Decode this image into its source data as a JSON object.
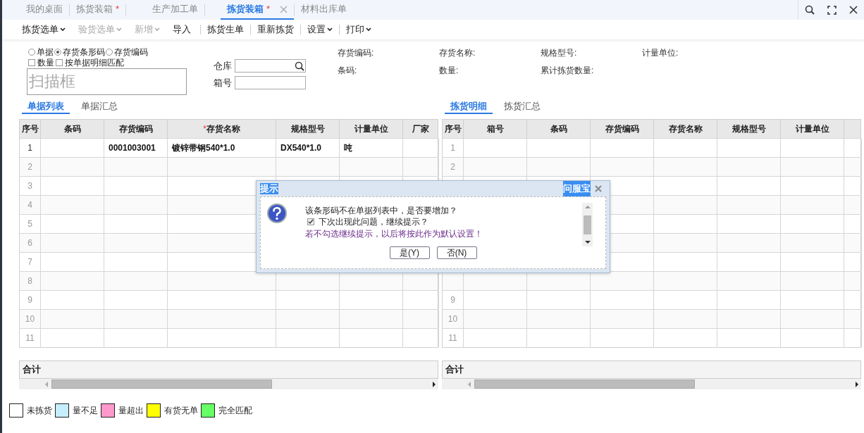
{
  "tabs": [
    {
      "label": "我的桌面",
      "dirty": false,
      "selected": false,
      "closable": false
    },
    {
      "label": "拣货装箱",
      "dirty": true,
      "selected": false,
      "closable": false
    },
    {
      "label": "生产加工单",
      "dirty": false,
      "selected": false,
      "closable": false
    },
    {
      "label": "拣货装箱",
      "dirty": true,
      "selected": true,
      "closable": true
    },
    {
      "label": "材料出库单",
      "dirty": false,
      "selected": false,
      "closable": false
    }
  ],
  "dirty_mark": "*",
  "toolbar": [
    {
      "label": "拣货选单",
      "dropdown": true,
      "disabled": false
    },
    {
      "label": "验货选单",
      "dropdown": true,
      "disabled": true
    },
    {
      "label": "新增",
      "dropdown": true,
      "disabled": true
    },
    {
      "label": "导入",
      "dropdown": false,
      "disabled": false
    },
    {
      "label": "拣货生单",
      "dropdown": false,
      "disabled": false
    },
    {
      "label": "重新拣货",
      "dropdown": false,
      "disabled": false
    },
    {
      "label": "设置",
      "dropdown": true,
      "disabled": false
    },
    {
      "label": "打印",
      "dropdown": true,
      "disabled": false
    }
  ],
  "scan_modes": [
    {
      "label": "单据",
      "selected": false
    },
    {
      "label": "存货条形码",
      "selected": true
    },
    {
      "label": "存货编码",
      "selected": false
    }
  ],
  "options": [
    {
      "label": "数量",
      "checked": false
    },
    {
      "label": "按单据明细匹配",
      "checked": false
    }
  ],
  "scan_box": {
    "placeholder": "扫描框"
  },
  "warehouse": {
    "label": "仓库"
  },
  "box_no": {
    "label": "箱号"
  },
  "info_labels": [
    "存货编码:",
    "存货名称:",
    "规格型号:",
    "计量单位:",
    "条码:",
    "数量:",
    "累计拣货数量:"
  ],
  "left_panel": {
    "tabs": [
      {
        "label": "单据列表",
        "selected": true
      },
      {
        "label": "单据汇总",
        "selected": false
      }
    ],
    "columns": [
      {
        "label": "序号",
        "required": false
      },
      {
        "label": "条码",
        "required": false
      },
      {
        "label": "存货编码",
        "required": false
      },
      {
        "label": "存货名称",
        "required": true
      },
      {
        "label": "规格型号",
        "required": false
      },
      {
        "label": "计量单位",
        "required": false
      },
      {
        "label": "厂家",
        "required": false
      }
    ],
    "rows": [
      {
        "kind": "data",
        "cells": [
          "1",
          "",
          "0001003001",
          "镀锌带钢540*1.0",
          "DX540*1.0",
          "吨",
          ""
        ]
      },
      {
        "kind": "blank",
        "cells": [
          "2"
        ]
      },
      {
        "kind": "blank",
        "cells": [
          "3"
        ]
      },
      {
        "kind": "blank",
        "cells": [
          "4"
        ]
      },
      {
        "kind": "blank",
        "cells": [
          "5"
        ]
      },
      {
        "kind": "blank",
        "cells": [
          "6"
        ]
      },
      {
        "kind": "blank",
        "cells": [
          "7"
        ]
      },
      {
        "kind": "blank",
        "cells": [
          "8"
        ]
      },
      {
        "kind": "blank",
        "cells": [
          "9"
        ]
      },
      {
        "kind": "blank",
        "cells": [
          "10"
        ]
      },
      {
        "kind": "blank",
        "cells": [
          "11"
        ]
      }
    ],
    "total_label": "合计"
  },
  "right_panel": {
    "tabs": [
      {
        "label": "拣货明细",
        "selected": true
      },
      {
        "label": "拣货汇总",
        "selected": false
      }
    ],
    "columns": [
      {
        "label": "序号",
        "required": false
      },
      {
        "label": "箱号",
        "required": false
      },
      {
        "label": "条码",
        "required": false
      },
      {
        "label": "存货编码",
        "required": false
      },
      {
        "label": "存货名称",
        "required": false
      },
      {
        "label": "规格型号",
        "required": false
      },
      {
        "label": "计量单位",
        "required": false
      },
      {}
    ],
    "rows": [
      {
        "kind": "blank",
        "cells": [
          "1"
        ]
      },
      {
        "kind": "blank",
        "cells": [
          "2"
        ]
      },
      {
        "kind": "blank"
      },
      {
        "kind": "blank"
      },
      {
        "kind": "blank"
      },
      {
        "kind": "blank"
      },
      {
        "kind": "blank"
      },
      {
        "kind": "blank"
      },
      {
        "kind": "blank",
        "cells": [
          "9"
        ]
      },
      {
        "kind": "blank",
        "cells": [
          "10"
        ]
      },
      {
        "kind": "blank",
        "cells": [
          "11"
        ]
      }
    ],
    "total_label": "合计"
  },
  "legend": [
    {
      "label": "未拣货",
      "color": "#ffffff"
    },
    {
      "label": "量不足",
      "color": "#c6eefc"
    },
    {
      "label": "量超出",
      "color": "#ff99cc"
    },
    {
      "label": "有货无单",
      "color": "#ffff00"
    },
    {
      "label": "完全匹配",
      "color": "#66ff66"
    }
  ],
  "dialog": {
    "title": "提示",
    "badge": "问服宝",
    "question": "该条形码不在单据列表中，是否要增加？",
    "remind": {
      "label": "下次出现此问题，继续提示？",
      "checked": true
    },
    "note": "若不勾选继续提示，以后将按此作为默认设置！",
    "buttons": [
      "是(Y)",
      "否(N)"
    ]
  }
}
